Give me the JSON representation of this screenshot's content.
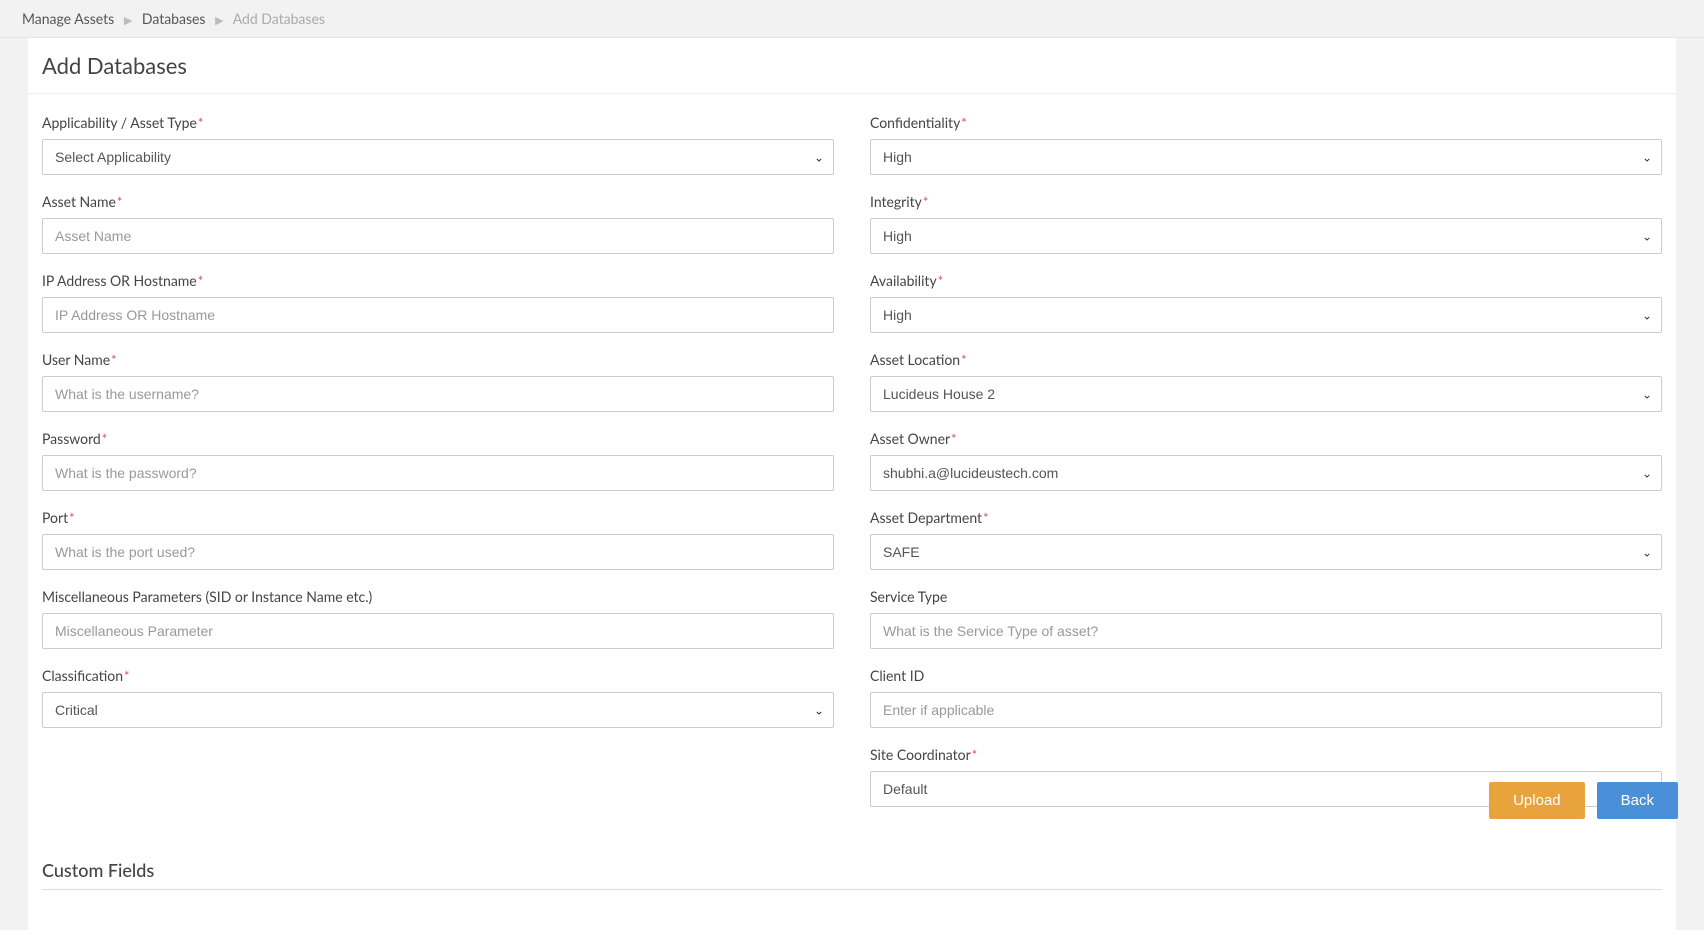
{
  "breadcrumb": {
    "root": "Manage Assets",
    "mid": "Databases",
    "current": "Add Databases"
  },
  "page_title": "Add Databases",
  "left": {
    "applicability": {
      "label": "Applicability / Asset Type",
      "value": "Select Applicability"
    },
    "asset_name": {
      "label": "Asset Name",
      "placeholder": "Asset Name"
    },
    "ip_host": {
      "label": "IP Address OR Hostname",
      "placeholder": "IP Address OR Hostname"
    },
    "user_name": {
      "label": "User Name",
      "placeholder": "What is the username?"
    },
    "password": {
      "label": "Password",
      "placeholder": "What is the password?"
    },
    "port": {
      "label": "Port",
      "placeholder": "What is the port used?"
    },
    "misc": {
      "label": "Miscellaneous Parameters (SID or Instance Name etc.)",
      "placeholder": "Miscellaneous Parameter"
    },
    "classification": {
      "label": "Classification",
      "value": "Critical"
    }
  },
  "right": {
    "confidentiality": {
      "label": "Confidentiality",
      "value": "High"
    },
    "integrity": {
      "label": "Integrity",
      "value": "High"
    },
    "availability": {
      "label": "Availability",
      "value": "High"
    },
    "asset_location": {
      "label": "Asset Location",
      "value": "Lucideus House 2"
    },
    "asset_owner": {
      "label": "Asset Owner",
      "value": "shubhi.a@lucideustech.com"
    },
    "asset_department": {
      "label": "Asset Department",
      "value": "SAFE"
    },
    "service_type": {
      "label": "Service Type",
      "placeholder": "What is the Service Type of asset?"
    },
    "client_id": {
      "label": "Client ID",
      "placeholder": "Enter if applicable"
    },
    "site_coordinator": {
      "label": "Site Coordinator",
      "value": "Default"
    }
  },
  "custom_fields_title": "Custom Fields",
  "buttons": {
    "upload": "Upload",
    "back": "Back"
  }
}
